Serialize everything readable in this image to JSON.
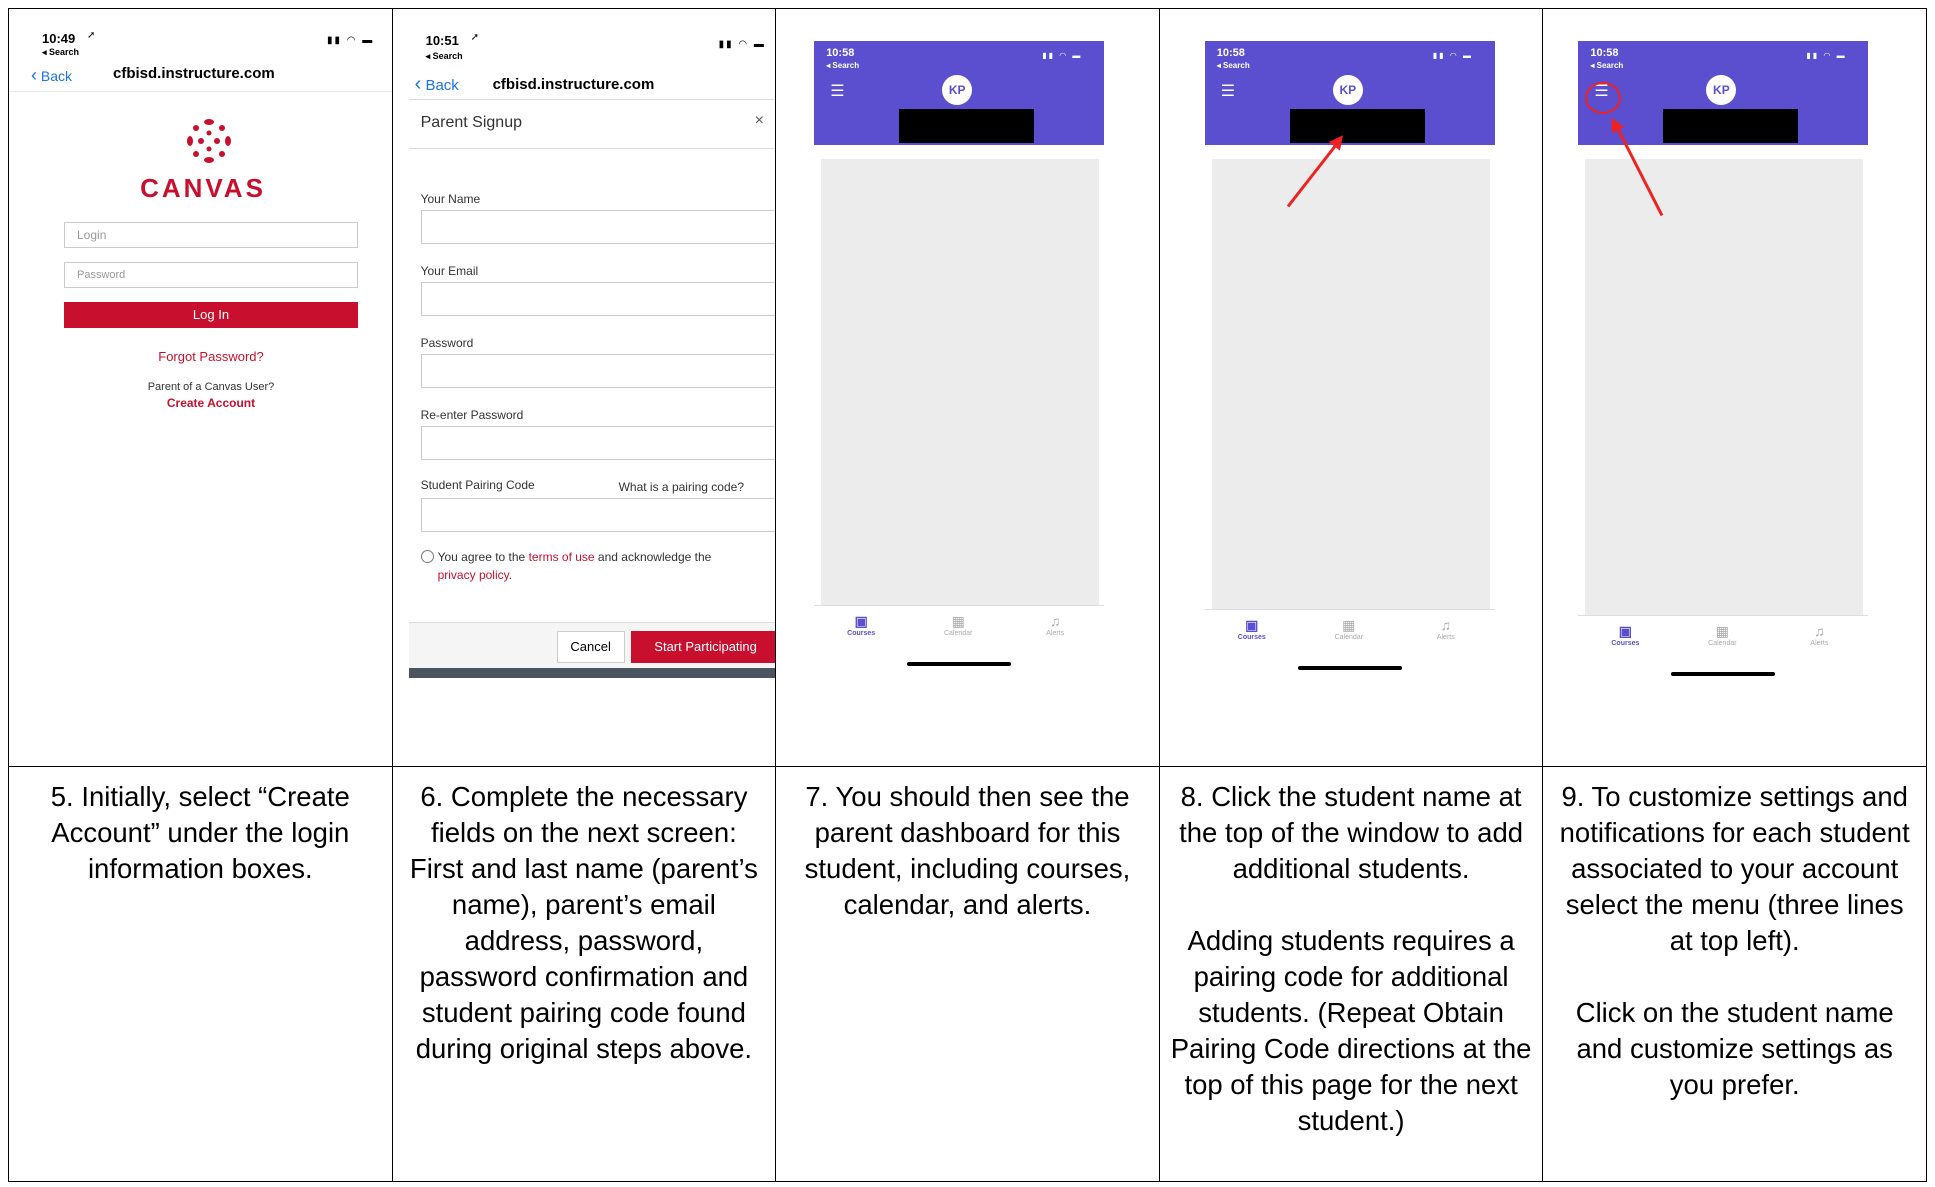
{
  "shot1": {
    "time": "10:49",
    "search": "◂ Search",
    "back": "Back",
    "host": "cfbisd.instructure.com",
    "brand": "CANVAS",
    "login_placeholder": "Login",
    "password_placeholder": "Password",
    "login_button": "Log In",
    "forgot": "Forgot Password?",
    "parent_q": "Parent of a Canvas User?",
    "create": "Create Account"
  },
  "shot2": {
    "time": "10:51",
    "search": "◂ Search",
    "back": "Back",
    "host": "cfbisd.instructure.com",
    "dialog_title": "Parent Signup",
    "close": "×",
    "your_name": "Your Name",
    "your_email": "Your Email",
    "password": "Password",
    "reenter": "Re-enter Password",
    "pairing": "Student Pairing Code",
    "what_pairing": "What is a pairing code?",
    "agree_pre": "You agree to the ",
    "terms": "terms of use",
    "agree_mid": " and acknowledge the",
    "privacy": "privacy policy",
    "cancel": "Cancel",
    "start": "Start Participating"
  },
  "dash": {
    "time": "10:58",
    "search": "◂ Search",
    "avatar": "KP",
    "tabs": [
      "Courses",
      "Calendar",
      "Alerts"
    ]
  },
  "colors": {
    "canvas_red": "#c8102e",
    "purple": "#5b4fcf",
    "annotation_red": "#e22222"
  },
  "captions": {
    "c5": [
      "5. Initially, select “Create Account” under the login information boxes."
    ],
    "c6": [
      "6. Complete the necessary fields on the next screen: First and last name (parent’s name), parent’s email address, password, password confirmation and student pairing code found during original steps above."
    ],
    "c7": [
      "7. You should then see the parent dashboard for this student, including courses, calendar, and alerts."
    ],
    "c8": [
      "8. Click the student name at the top of the window to add additional students.",
      "Adding students requires a pairing code for additional students. (Repeat Obtain Pairing Code directions at the top of this page for the next student.)"
    ],
    "c9": [
      "9. To customize settings and notifications for each student associated to your account select the menu (three lines at top left).",
      "Click on the student name and customize settings as you prefer."
    ]
  }
}
